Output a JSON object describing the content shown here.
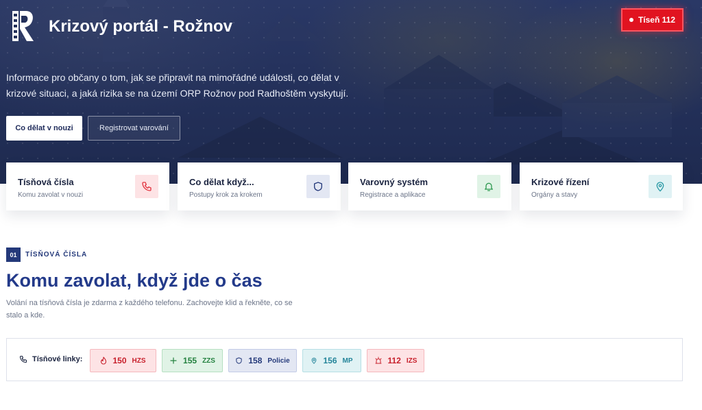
{
  "header": {
    "site_title": "Krizový portál - Rožnov",
    "emergency_button": "Tíseň 112"
  },
  "hero": {
    "intro_line1": "Informace pro občany o tom, jak se připravit na mimořádné události, co dělat v",
    "intro_line2": "krizové situaci, a jaká rizika se na území ORP Rožnov pod Radhoštěm vyskytují.",
    "primary_button": "Co dělat v nouzi",
    "secondary_button": "Registrovat varování"
  },
  "cards": [
    {
      "title": "Tísňová čísla",
      "subtitle": "Komu zavolat v nouzi",
      "icon": "phone-icon",
      "color": "#e2343f",
      "bg": "#fde3e5"
    },
    {
      "title": "Co dělat když...",
      "subtitle": "Postupy krok za krokem",
      "icon": "shield-icon",
      "color": "#24397a",
      "bg": "#e3e7f3"
    },
    {
      "title": "Varovný systém",
      "subtitle": "Registrace a aplikace",
      "icon": "bell-icon",
      "color": "#2f9a52",
      "bg": "#e0f3e6"
    },
    {
      "title": "Krizové řízení",
      "subtitle": "Orgány a stavy",
      "icon": "map-pin-icon",
      "color": "#2a9aa6",
      "bg": "#e0f2f4"
    }
  ],
  "section": {
    "number": "01",
    "label": "TÍSŇOVÁ ČÍSLA",
    "title": "Komu zavolat, když jde o čas",
    "desc_line1": "Volání na tísňová čísla je zdarma z každého telefonu. Zachovejte klid a řekněte, co se",
    "desc_line2": "stalo a kde."
  },
  "emergency_lines": {
    "label": "Tísňové linky:",
    "items": [
      {
        "number": "150",
        "abbr": "HZS",
        "icon": "flame-icon",
        "color": "#c8202c",
        "bg": "#fde3e5",
        "border": "#f5b8bd"
      },
      {
        "number": "155",
        "abbr": "ZZS",
        "icon": "plus-icon",
        "color": "#23813f",
        "bg": "#e0f3e6",
        "border": "#b6e0c2"
      },
      {
        "number": "158",
        "abbr": "Policie",
        "icon": "shield-icon",
        "color": "#24397a",
        "bg": "#e3e7f3",
        "border": "#c2cbe6"
      },
      {
        "number": "156",
        "abbr": "MP",
        "icon": "map-pin-icon",
        "color": "#24859a",
        "bg": "#e0f2f4",
        "border": "#b6dfe5"
      },
      {
        "number": "112",
        "abbr": "IZS",
        "icon": "siren-icon",
        "color": "#c8202c",
        "bg": "#fde3e5",
        "border": "#f5b8bd"
      }
    ]
  }
}
